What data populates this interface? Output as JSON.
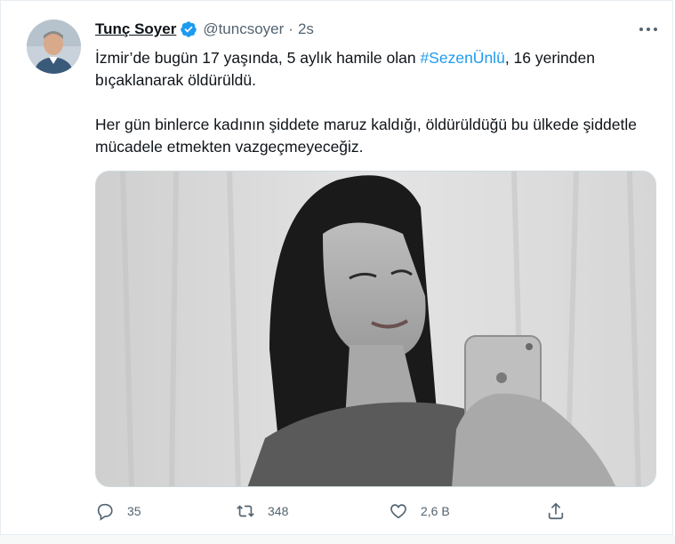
{
  "tweet": {
    "author_name": "Tunç Soyer",
    "author_handle": "@tuncsoyer",
    "separator": "·",
    "time": "2s",
    "text_line1_before": "İzmir’de bugün 17 yaşında, 5 aylık hamile olan ",
    "hashtag": "#SezenÜnlü",
    "text_line1_after": ", 16 yerinden bıçaklanarak öldürüldü.",
    "text_para2": "Her gün binlerce kadının şiddete maruz kaldığı, öldürüldüğü bu ülkede şiddetle mücadele etmekten  vazgeçmeyeceğiz.",
    "media_icon": "photo",
    "avatar_icon": "user-avatar",
    "verified_icon": "verified-badge"
  },
  "actions": {
    "reply_count": "35",
    "retweet_count": "348",
    "like_count": "2,6 B",
    "reply_icon": "reply-icon",
    "retweet_icon": "retweet-icon",
    "like_icon": "heart-icon",
    "share_icon": "share-icon",
    "more_icon": "more-icon"
  },
  "colors": {
    "accent": "#1d9bf0",
    "secondary_text": "#536471",
    "border": "#cfd9de"
  }
}
